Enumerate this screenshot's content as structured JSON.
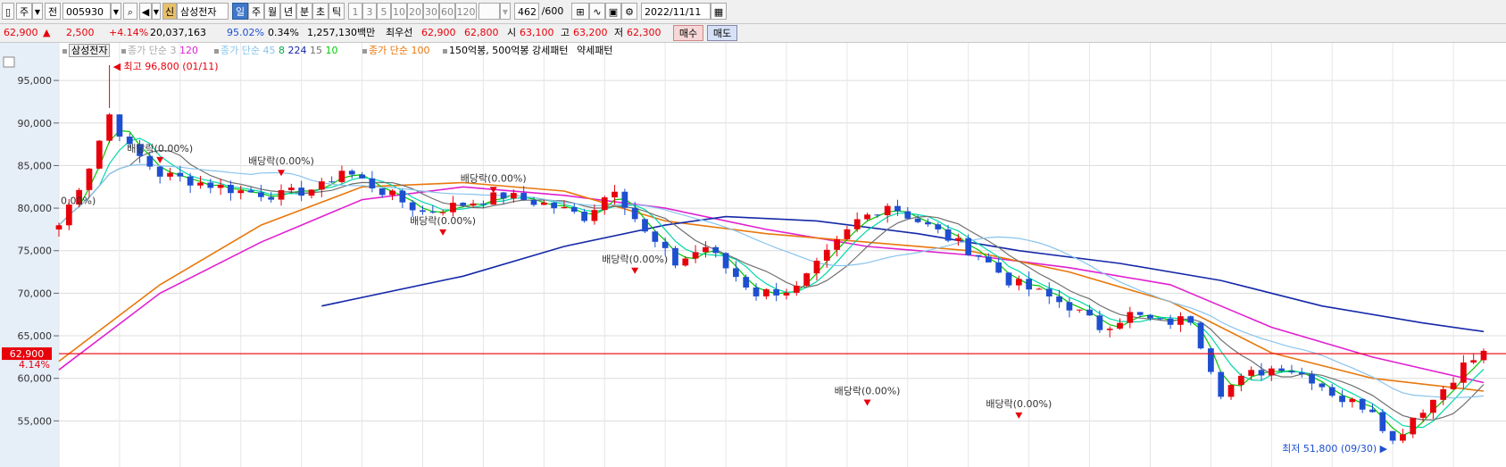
{
  "toolbar": {
    "mode_label": "주",
    "prev_label": "전",
    "stock_code": "005930",
    "stock_badge": "신",
    "stock_name": "삼성전자",
    "periods": [
      "일",
      "주",
      "월",
      "년",
      "분",
      "초",
      "틱"
    ],
    "active_period": "일",
    "numbers": [
      "1",
      "3",
      "5",
      "10",
      "20",
      "30",
      "60",
      "120"
    ],
    "count": "462",
    "total": "/600",
    "date": "2022/11/11"
  },
  "quote": {
    "price": "62,900",
    "change": "2,500",
    "change_pct": "+4.14%",
    "volume": "20,037,163",
    "ratio": "95.02%",
    "turnover_pct": "0.34%",
    "amount": "1,257,130백만",
    "best_label": "최우선",
    "best_ask": "62,900",
    "best_bid": "62,800",
    "open_label": "시",
    "open": "63,100",
    "high_label": "고",
    "high": "63,200",
    "low_label": "저",
    "low": "62,300",
    "buy_label": "매수",
    "sell_label": "매도"
  },
  "legend": {
    "name": "삼성전자",
    "ma_short_label": "종가 단순 3",
    "ma_short_value": "120",
    "ma_mid_label": "종가 단순 45",
    "ma_mid_values": [
      "8",
      "224",
      "15",
      "10"
    ],
    "ma_long_label": "종가 단순 100",
    "pattern_label": "150억봉, 500억봉 강세패턴",
    "weak_label": "약세패턴"
  },
  "annotations": {
    "high": "최고 96,800 (01/11)",
    "low": "최저 51,800 (09/30)",
    "dividend": "배당락(0.00%)",
    "dividend_short": "0.00%)",
    "current_price": "62,900",
    "current_pct": "4.14%"
  },
  "colors": {
    "up": "#e8000b",
    "down": "#1e4fd0",
    "ma_magenta": "#e020d0",
    "ma_orange": "#e8780c",
    "ma_navy": "#1428a8",
    "ma_lightblue": "#88c4ec",
    "ma_green": "#00c800",
    "ma_teal": "#00d8a8",
    "ma_gray": "#707070",
    "price_line": "#e8000b"
  },
  "chart_data": {
    "type": "candlestick",
    "y_ticks": [
      95000,
      90000,
      85000,
      80000,
      75000,
      70000,
      65000,
      60000,
      55000
    ],
    "ylim": [
      50000,
      99000
    ],
    "close_path": [
      [
        0,
        78000
      ],
      [
        3,
        85000
      ],
      [
        5,
        91000
      ],
      [
        7,
        87000
      ],
      [
        10,
        84000
      ],
      [
        14,
        83000
      ],
      [
        18,
        82000
      ],
      [
        22,
        81500
      ],
      [
        26,
        82500
      ],
      [
        28,
        84500
      ],
      [
        32,
        82000
      ],
      [
        36,
        79500
      ],
      [
        40,
        80500
      ],
      [
        44,
        81500
      ],
      [
        48,
        80500
      ],
      [
        52,
        79000
      ],
      [
        55,
        82500
      ],
      [
        58,
        77000
      ],
      [
        61,
        73500
      ],
      [
        64,
        75500
      ],
      [
        66,
        73000
      ],
      [
        69,
        70000
      ],
      [
        73,
        70500
      ],
      [
        76,
        74500
      ],
      [
        79,
        78500
      ],
      [
        82,
        80500
      ],
      [
        85,
        78500
      ],
      [
        88,
        76500
      ],
      [
        91,
        74500
      ],
      [
        94,
        71500
      ],
      [
        97,
        70000
      ],
      [
        100,
        68500
      ],
      [
        103,
        66000
      ],
      [
        106,
        67500
      ],
      [
        109,
        66500
      ],
      [
        112,
        67000
      ],
      [
        115,
        58500
      ],
      [
        118,
        60500
      ],
      [
        121,
        61500
      ],
      [
        124,
        60000
      ],
      [
        127,
        57500
      ],
      [
        130,
        56500
      ],
      [
        132,
        52500
      ],
      [
        134,
        55500
      ],
      [
        136,
        57500
      ],
      [
        139,
        61500
      ],
      [
        141,
        62900
      ]
    ],
    "moving_averages": [
      {
        "name": "magenta",
        "points": [
          [
            0,
            61000
          ],
          [
            10,
            70000
          ],
          [
            20,
            76000
          ],
          [
            30,
            81000
          ],
          [
            40,
            82500
          ],
          [
            50,
            81500
          ],
          [
            60,
            80000
          ],
          [
            70,
            77500
          ],
          [
            80,
            75500
          ],
          [
            90,
            74500
          ],
          [
            100,
            73000
          ],
          [
            110,
            71000
          ],
          [
            120,
            66000
          ],
          [
            130,
            62500
          ],
          [
            141,
            59500
          ]
        ]
      },
      {
        "name": "orange",
        "points": [
          [
            0,
            62000
          ],
          [
            10,
            71000
          ],
          [
            20,
            78000
          ],
          [
            30,
            82500
          ],
          [
            40,
            83000
          ],
          [
            50,
            82000
          ],
          [
            60,
            78500
          ],
          [
            70,
            77000
          ],
          [
            80,
            76000
          ],
          [
            90,
            75000
          ],
          [
            100,
            72500
          ],
          [
            110,
            69000
          ],
          [
            120,
            63000
          ],
          [
            130,
            60000
          ],
          [
            141,
            58500
          ]
        ]
      },
      {
        "name": "navy",
        "points": [
          [
            26,
            68500
          ],
          [
            40,
            72000
          ],
          [
            50,
            75500
          ],
          [
            60,
            78000
          ],
          [
            66,
            79000
          ],
          [
            75,
            78500
          ],
          [
            85,
            77000
          ],
          [
            95,
            75000
          ],
          [
            105,
            73500
          ],
          [
            115,
            71500
          ],
          [
            125,
            68500
          ],
          [
            135,
            66500
          ],
          [
            141,
            65500
          ]
        ]
      }
    ]
  }
}
